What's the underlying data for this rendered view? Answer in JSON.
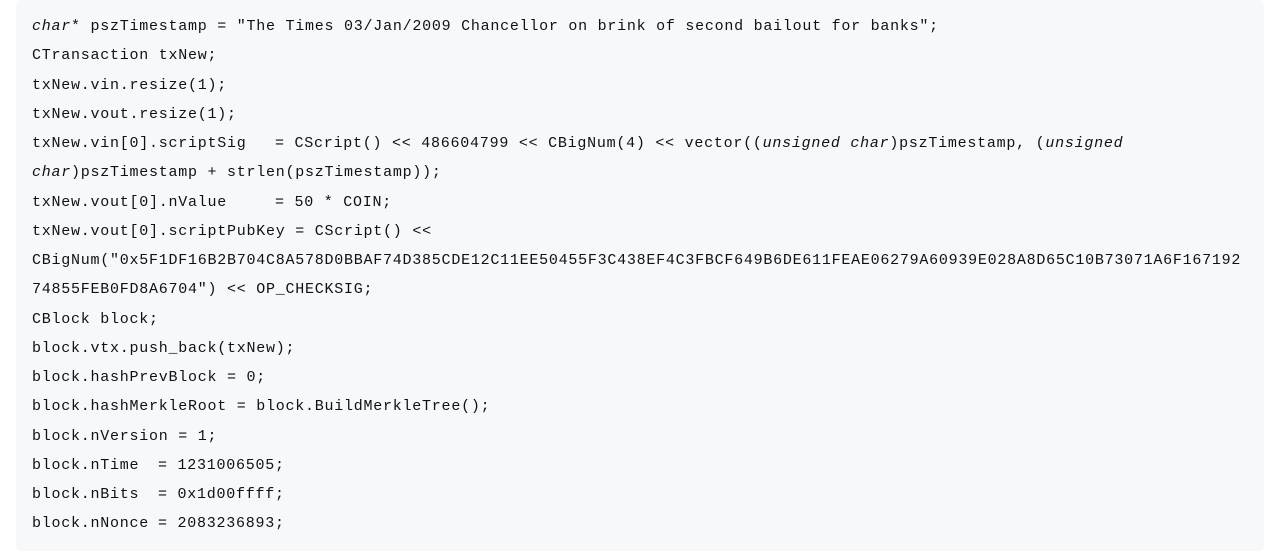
{
  "code": {
    "line1_a": "char",
    "line1_b": "* pszTimestamp = \"The Times 03/Jan/2009 Chancellor on brink of second bailout for banks\";",
    "line2": "CTransaction txNew;",
    "line3": "txNew.vin.resize(1);",
    "line4": "txNew.vout.resize(1);",
    "line5_lhs": "txNew.vin[0].scriptSig",
    "line5_rhs_a": "= CScript() << 486604799 << CBigNum(4) << vector((",
    "line5_rhs_b": "unsigned char",
    "line5_rhs_c": ")pszTimestamp, (",
    "line5_rhs_d": "unsigned char",
    "line5_rhs_e": ")pszTimestamp + strlen(pszTimestamp));",
    "line6_lhs": "txNew.vout[0].nValue",
    "line6_rhs": "= 50 * COIN;",
    "line7_lhs": "txNew.vout[0].scriptPubKey ",
    "line7_rhs": "= CScript() << CBigNum(\"0x5F1DF16B2B704C8A578D0BBAF74D385CDE12C11EE50455F3C438EF4C3FBCF649B6DE611FEAE06279A60939E028A8D65C10B73071A6F16719274855FEB0FD8A6704\") << OP_CHECKSIG;",
    "line8": "CBlock block;",
    "line9": "block.vtx.push_back(txNew);",
    "line10": "block.hashPrevBlock = 0;",
    "line11": "block.hashMerkleRoot = block.BuildMerkleTree();",
    "line12": "block.nVersion = 1;",
    "line13_lhs": "block.nTime",
    "line13_rhs": "= 1231006505;",
    "line14_lhs": "block.nBits",
    "line14_rhs": "= 0x1d00ffff;",
    "line15_lhs": "block.nNonce",
    "line15_rhs": "= 2083236893;"
  }
}
